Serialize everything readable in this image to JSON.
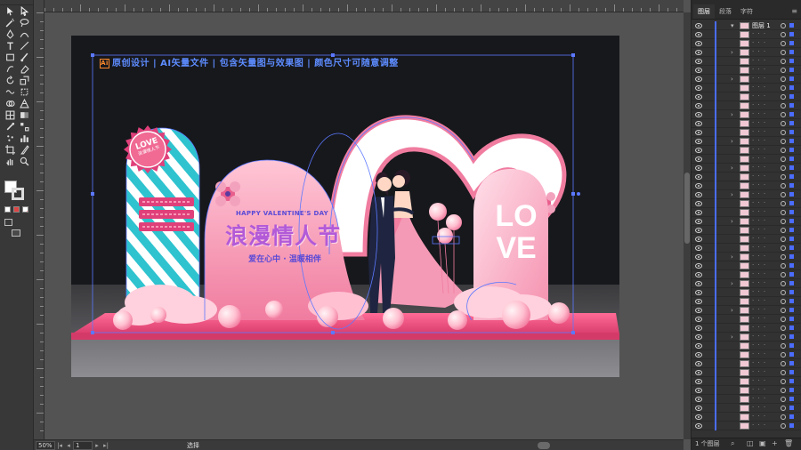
{
  "artboard": {
    "slogan": "原创设计 | AI矢量文件 | 包含矢量图与效果图 | 颜色尺寸可随意调整",
    "ai_badge": "Ai",
    "love_badge": "LOVE",
    "love_badge_sub": "浪漫情人节",
    "ribbons": [
      "",
      "",
      ""
    ],
    "eng_title": "HAPPY VALENTINE'S DAY",
    "main_title": "浪漫情人节",
    "sub_title": "爱在心中 · 温暖相伴",
    "love_big_1": "LO",
    "love_big_2": "VE"
  },
  "status_bar": {
    "zoom": "50%",
    "page": "1",
    "mode": "选择"
  },
  "panel": {
    "tabs": [
      "图层",
      "段落",
      "字符"
    ],
    "top_layer": "图层 1",
    "footer_count": "1 个图层"
  },
  "colors": {
    "accent_blue": "#5b78ff",
    "pink": "#f07ca0",
    "cyan": "#2ec3cf",
    "magenta": "#e0407a",
    "artboard_bg": "#17181c"
  },
  "icons": {
    "selection": "selection-tool-icon",
    "direct_selection": "direct-selection-tool-icon",
    "pen": "pen-tool-icon",
    "type": "type-tool-icon",
    "rectangle": "rectangle-tool-icon",
    "hand": "hand-tool-icon",
    "zoom": "zoom-tool-icon"
  }
}
